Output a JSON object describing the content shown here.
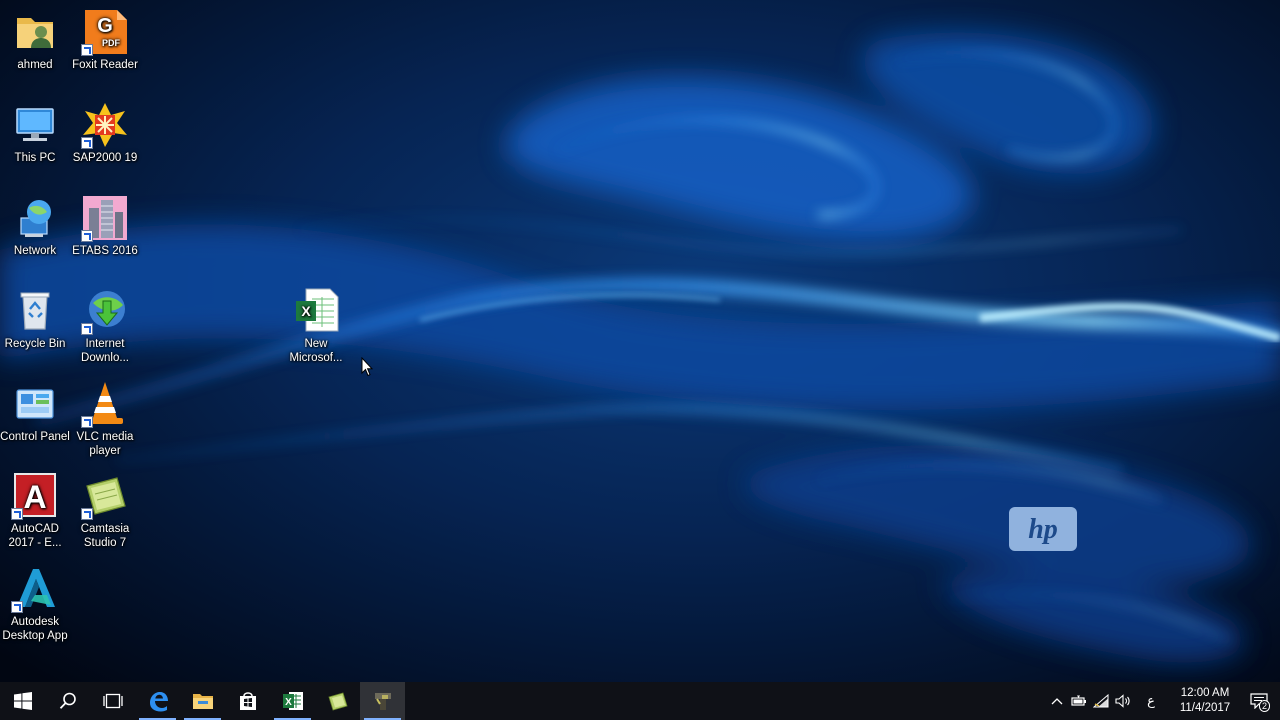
{
  "desktop": {
    "icons": [
      {
        "label": "ahmed",
        "icon": "user-folder-icon"
      },
      {
        "label": "Foxit Reader",
        "icon": "foxit-reader-icon"
      },
      {
        "label": "This PC",
        "icon": "this-pc-icon"
      },
      {
        "label": "SAP2000 19",
        "icon": "sap2000-icon"
      },
      {
        "label": "Network",
        "icon": "network-icon"
      },
      {
        "label": "ETABS 2016",
        "icon": "etabs-icon"
      },
      {
        "label": "Recycle Bin",
        "icon": "recycle-bin-icon"
      },
      {
        "label": "Internet Downlo...",
        "icon": "internet-download-manager-icon"
      },
      {
        "label": "Control Panel",
        "icon": "control-panel-icon"
      },
      {
        "label": "VLC media player",
        "icon": "vlc-icon"
      },
      {
        "label": "AutoCAD 2017 - E...",
        "icon": "autocad-icon"
      },
      {
        "label": "Camtasia Studio 7",
        "icon": "camtasia-icon"
      },
      {
        "label": "Autodesk Desktop App",
        "icon": "autodesk-desktop-app-icon"
      },
      {
        "label": "New Microsof...",
        "icon": "excel-file-icon"
      }
    ],
    "wallpaper_logo": "hp-logo",
    "colors": {
      "wallpaper_dark": "#020818",
      "wallpaper_glow": "#2f8fff",
      "taskbar": "#0f1117"
    }
  },
  "taskbar": {
    "buttons": [
      {
        "icon": "windows-start-icon"
      },
      {
        "icon": "search-icon"
      },
      {
        "icon": "task-view-icon"
      },
      {
        "icon": "edge-icon"
      },
      {
        "icon": "file-explorer-icon"
      },
      {
        "icon": "store-icon"
      },
      {
        "icon": "excel-icon"
      },
      {
        "icon": "camtasia-icon"
      },
      {
        "icon": "camtasia-recorder-icon"
      }
    ],
    "tray": {
      "icons": [
        "chevron-up-icon",
        "battery-icon",
        "wifi-icon",
        "volume-icon"
      ],
      "language": "ع",
      "time": "12:00 AM",
      "date": "11/4/2017",
      "notification_count": "2"
    }
  }
}
